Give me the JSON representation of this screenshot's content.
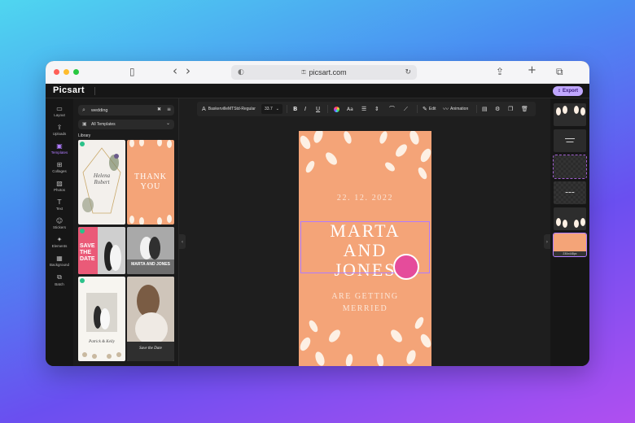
{
  "browser": {
    "url": "picsart.com",
    "icons": {
      "sidebar": "sidebar-icon",
      "back": "‹",
      "forward": "›",
      "share": "⇪",
      "new_tab": "+",
      "tabs": "⧉",
      "lock": "🔒",
      "shield": "◐",
      "reload": "↻"
    }
  },
  "app": {
    "logo": "Picsart",
    "export_label": "Export"
  },
  "rail": [
    {
      "label": "Layout",
      "icon": "▭"
    },
    {
      "label": "Uploads",
      "icon": "⇪"
    },
    {
      "label": "Templates",
      "icon": "▣",
      "active": true
    },
    {
      "label": "Collages",
      "icon": "⊞"
    },
    {
      "label": "Photos",
      "icon": "▨"
    },
    {
      "label": "Text",
      "icon": "T"
    },
    {
      "label": "Stickers",
      "icon": "☺"
    },
    {
      "label": "Elements",
      "icon": "✦"
    },
    {
      "label": "Background",
      "icon": "▦"
    },
    {
      "label": "Batch",
      "icon": "⧉"
    }
  ],
  "panel": {
    "search_value": "wedding",
    "dropdown_value": "All Templates",
    "library_label": "Library",
    "thumbs": [
      {
        "text": [
          "Helena",
          "Robert"
        ]
      },
      {
        "text": [
          "THANK",
          "YOU"
        ]
      },
      {
        "text": [
          "SAVE",
          "THE",
          "DATE"
        ]
      },
      {
        "text": [
          "MARTA AND JONES"
        ]
      },
      {
        "text": [
          "Patrick & Kelly"
        ]
      },
      {
        "text": [
          "Save the Date"
        ]
      }
    ]
  },
  "toolbar": {
    "font_name": "BaskervilleMTStd-Regular",
    "font_size": "33.7",
    "bold": "B",
    "italic": "I",
    "underline": "U",
    "case": "Aa",
    "edit_label": "Edit",
    "animation_label": "Animation"
  },
  "card": {
    "date": "22. 12. 2022",
    "names": [
      "MARTA",
      "AND",
      "JONES"
    ],
    "subtitle": [
      "ARE GETTING",
      "MERRIED"
    ],
    "colors": {
      "background": "#f4a478",
      "leaf": "#fdf0e4"
    }
  },
  "pages": [
    {
      "label": ""
    },
    {
      "label": ""
    },
    {
      "label": ""
    },
    {
      "label": ""
    },
    {
      "label": ""
    },
    {
      "label": "230x448px"
    }
  ]
}
